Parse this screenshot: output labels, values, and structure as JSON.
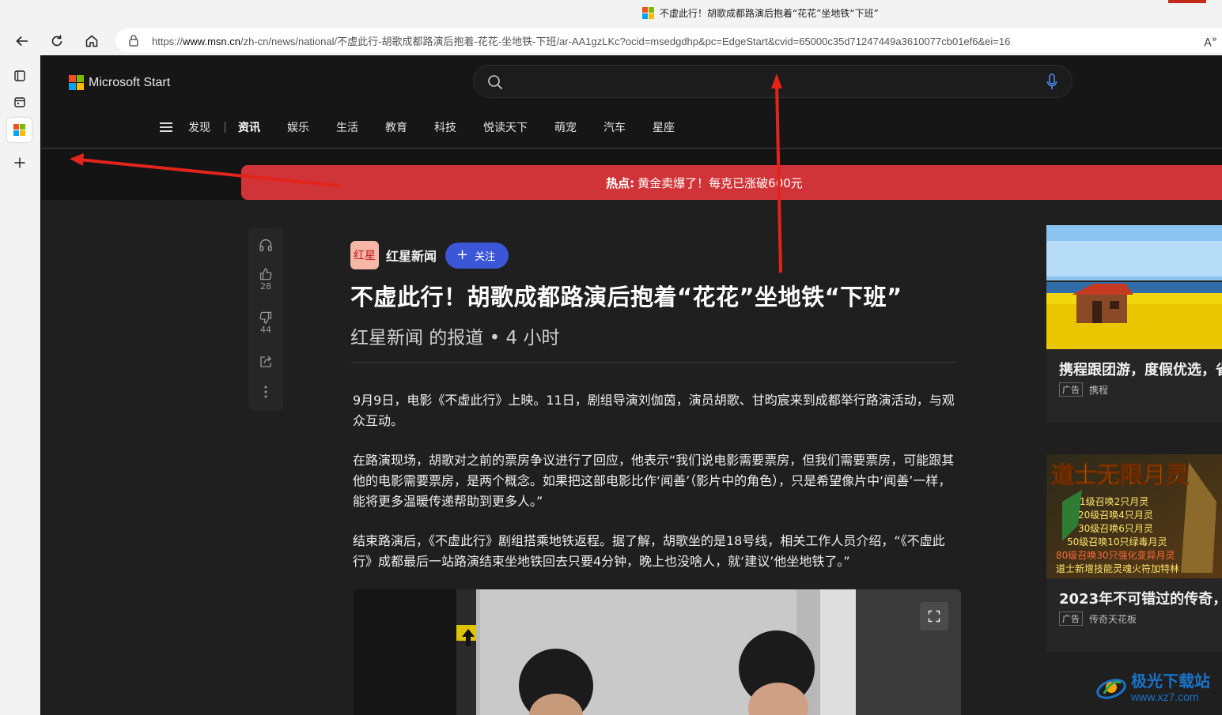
{
  "browser": {
    "tab_title": "不虚此行！胡歌成都路演后抱着“花花”坐地铁“下班”",
    "url_prefix": "https://",
    "url_domain": "www.msn.cn",
    "url_path": "/zh-cn/news/national/不虚此行-胡歌成都路演后抱着-花花-坐地铁-下班/ar-AA1gzLKc?ocid=msedgdhp&pc=EdgeStart&cvid=65000c35d71247449a3610077cb01ef6&ei=16",
    "read_aloud_label": "A",
    "read_aloud_suffix": "»",
    "accent_color": "#c42b1c"
  },
  "sidebar_icons": [
    "tab-actions-icon",
    "collections-icon",
    "microsoft-start-icon",
    "add-icon"
  ],
  "site": {
    "brand": "Microsoft Start",
    "nav": [
      {
        "label": "发现"
      },
      {
        "label": "资讯"
      },
      {
        "label": "娱乐"
      },
      {
        "label": "生活"
      },
      {
        "label": "教育"
      },
      {
        "label": "科技"
      },
      {
        "label": "悦读天下"
      },
      {
        "label": "萌宠"
      },
      {
        "label": "汽车"
      },
      {
        "label": "星座"
      }
    ],
    "active_nav": "资讯"
  },
  "hot_banner": {
    "prefix": "热点:",
    "text": "黄金卖爆了！每克已涨破600元",
    "color": "#d13438"
  },
  "actions": {
    "like_count": "28",
    "dislike_count": "44"
  },
  "article": {
    "source_logo_text": "红星",
    "source_name": "红星新闻",
    "follow_label": "关注",
    "follow_icon": "+",
    "headline": "不虚此行！胡歌成都路演后抱着“花花”坐地铁“下班”",
    "byline": "红星新闻 的报道 • 4 小时",
    "paragraphs": [
      "9月9日，电影《不虚此行》上映。11日，剧组导演刘伽茵，演员胡歌、甘昀宸来到成都举行路演活动，与观众互动。",
      "在路演现场，胡歌对之前的票房争议进行了回应，他表示“我们说电影需要票房，但我们需要票房，可能跟其他的电影需要票房，是两个概念。如果把这部电影比作‘闻善’（影片中的角色），只是希望像片中‘闻善’一样，能将更多温暖传递帮助到更多人。”",
      "结束路演后，《不虚此行》剧组搭乘地铁返程。据了解，胡歌坐的是18号线，相关工作人员介绍，“《不虚此行》成都最后一站路演结束坐地铁回去只要4分钟，晚上也没啥人，就‘建议’他坐地铁了。”"
    ]
  },
  "ads": [
    {
      "title": "携程跟团游，度假优选，省",
      "tag": "广告",
      "advertiser": "携程"
    },
    {
      "title": "2023年不可错过的传奇，",
      "tag": "广告",
      "advertiser": "传奇天花板",
      "image_text": {
        "title": "道士无限月灵",
        "lines": [
          "1级召唤2只月灵",
          "20级召唤4只月灵",
          "30级召唤6只月灵",
          "50级召唤10只绿毒月灵",
          "80级召唤30只强化变异月灵",
          "道士新增技能灵魂火符加特林"
        ]
      }
    }
  ],
  "watermark": {
    "main": "极光下载站",
    "url": "www.xz7.com"
  }
}
